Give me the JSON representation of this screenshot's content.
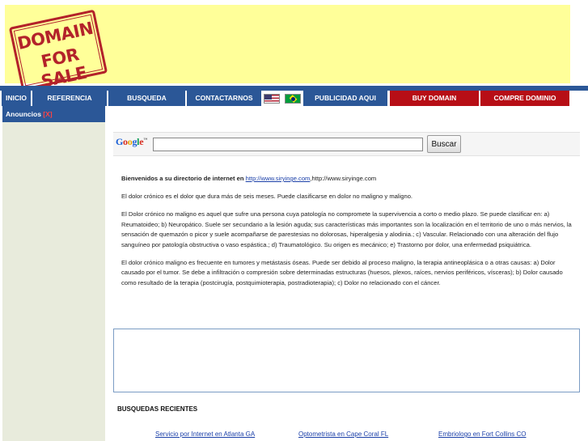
{
  "banner": {
    "stamp_line1": "DOMAIN",
    "stamp_line2": "FOR SALE",
    "background": "#ffff99",
    "stamp_color": "#b3222a"
  },
  "nav": {
    "items": [
      {
        "label": "INICIO",
        "color": "blue"
      },
      {
        "label": "REFERENCIA",
        "color": "blue"
      },
      {
        "label": "BUSQUEDA",
        "color": "blue"
      },
      {
        "label": "CONTACTARNOS",
        "color": "blue"
      },
      {
        "label": "PUBLICIDAD AQUI",
        "color": "blue"
      },
      {
        "label": "BUY DOMAIN",
        "color": "red"
      },
      {
        "label": "COMPRE DOMINIO",
        "color": "red"
      }
    ],
    "flags": [
      "us-flag-icon",
      "brazil-flag-icon"
    ],
    "blue": "#2b5797",
    "red": "#b70e16"
  },
  "sidebar": {
    "title": "Anouncios",
    "count": "[X]"
  },
  "search": {
    "logo_text": "Google",
    "logo_tm": "™",
    "input_value": "",
    "button_label": "Buscar"
  },
  "content": {
    "welcome_bold": "Bienvenidos a su directorio de internet en",
    "welcome_link": "http://www.siryinge.com",
    "welcome_tail": ",http://www.siryinge.com",
    "paragraphs": [
      "El dolor crónico es el dolor que dura más de seis meses. Puede clasificarse en dolor no maligno y maligno.",
      "El Dolor crónico no maligno es aquel que sufre una persona cuya patología no compromete la supervivencia a corto o medio plazo. Se puede clasificar en: a) Reumatoideo; b) Neuropático. Suele ser secundario a la lesión aguda; sus características más importantes son la localización en el territorio de uno o más nervios, la sensación de quemazón o picor y suele acompañarse de parestesias no dolorosas, hiperalgesia y alodinia.; c) Vascular. Relacionado con una alteración del flujo sanguíneo por patología obstructiva o vaso espástica.; d) Traumatológico. Su origen es mecánico; e) Trastorno por dolor, una enfermedad psiquiátrica.",
      "El dolor crónico maligno es frecuente en tumores y metástasis óseas. Puede ser debido al proceso maligno, la terapia antineoplásica o a otras causas:  a) Dolor causado por el tumor. Se debe a infiltración o compresión sobre determinadas estructuras (huesos, plexos, raíces, nervios periféricos, vísceras); b) Dolor causado como resultado de la terapia (postcirugía, postquimioterapia, postradioterapia); c) Dolor no relacionado con el cáncer."
    ]
  },
  "recent": {
    "title": "BUSQUEDAS RECIENTES",
    "links": [
      "Servicio por Internet en Atlanta GA",
      "Optometrista en Cape Coral FL",
      "Embriologo en Fort Collins CO"
    ]
  }
}
